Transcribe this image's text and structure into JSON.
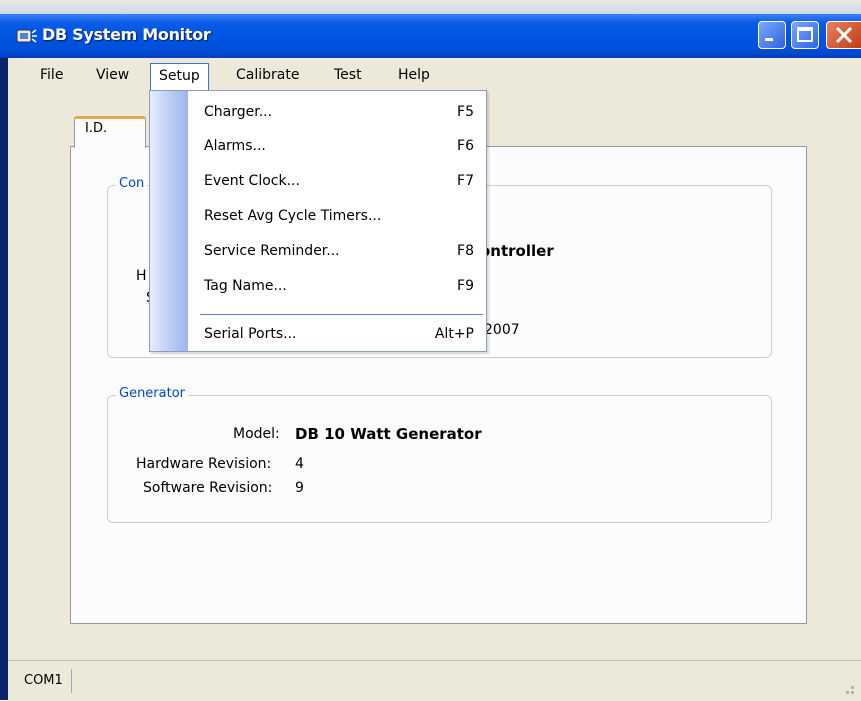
{
  "window": {
    "title": "DB System Monitor",
    "controls": [
      "minimize-icon",
      "maximize-icon",
      "close-icon"
    ]
  },
  "menubar": {
    "items": [
      "File",
      "View",
      "Setup",
      "Calibrate",
      "Test",
      "Help"
    ],
    "open_item": "Setup"
  },
  "setup_menu": {
    "items": [
      {
        "label": "Charger...",
        "shortcut": "F5"
      },
      {
        "label": "Alarms...",
        "shortcut": "F6"
      },
      {
        "label": "Event Clock...",
        "shortcut": "F7"
      },
      {
        "label": "Reset Avg Cycle Timers...",
        "shortcut": ""
      },
      {
        "label": "Service Reminder...",
        "shortcut": "F8"
      },
      {
        "label": "Tag Name...",
        "shortcut": "F9"
      },
      {
        "label": "Serial Ports...",
        "shortcut": "Alt+P"
      }
    ]
  },
  "tabs": {
    "active": "I.D."
  },
  "controller_group": {
    "label_visible": "Con",
    "model_fragment": "ontroller",
    "hw_fragment": "H",
    "sw_fragment": "S",
    "date_fragment": "2007"
  },
  "generator_group": {
    "label": "Generator",
    "model_label": "Model:",
    "model_value": "DB 10 Watt Generator",
    "hw_label": "Hardware Revision:",
    "hw_value": "4",
    "sw_label": "Software Revision:",
    "sw_value": "9"
  },
  "statusbar": {
    "port": "COM1"
  },
  "colors": {
    "titlebar": "#0054e3",
    "group_label": "#0046d5",
    "tab_highlight": "#e6a84e"
  }
}
